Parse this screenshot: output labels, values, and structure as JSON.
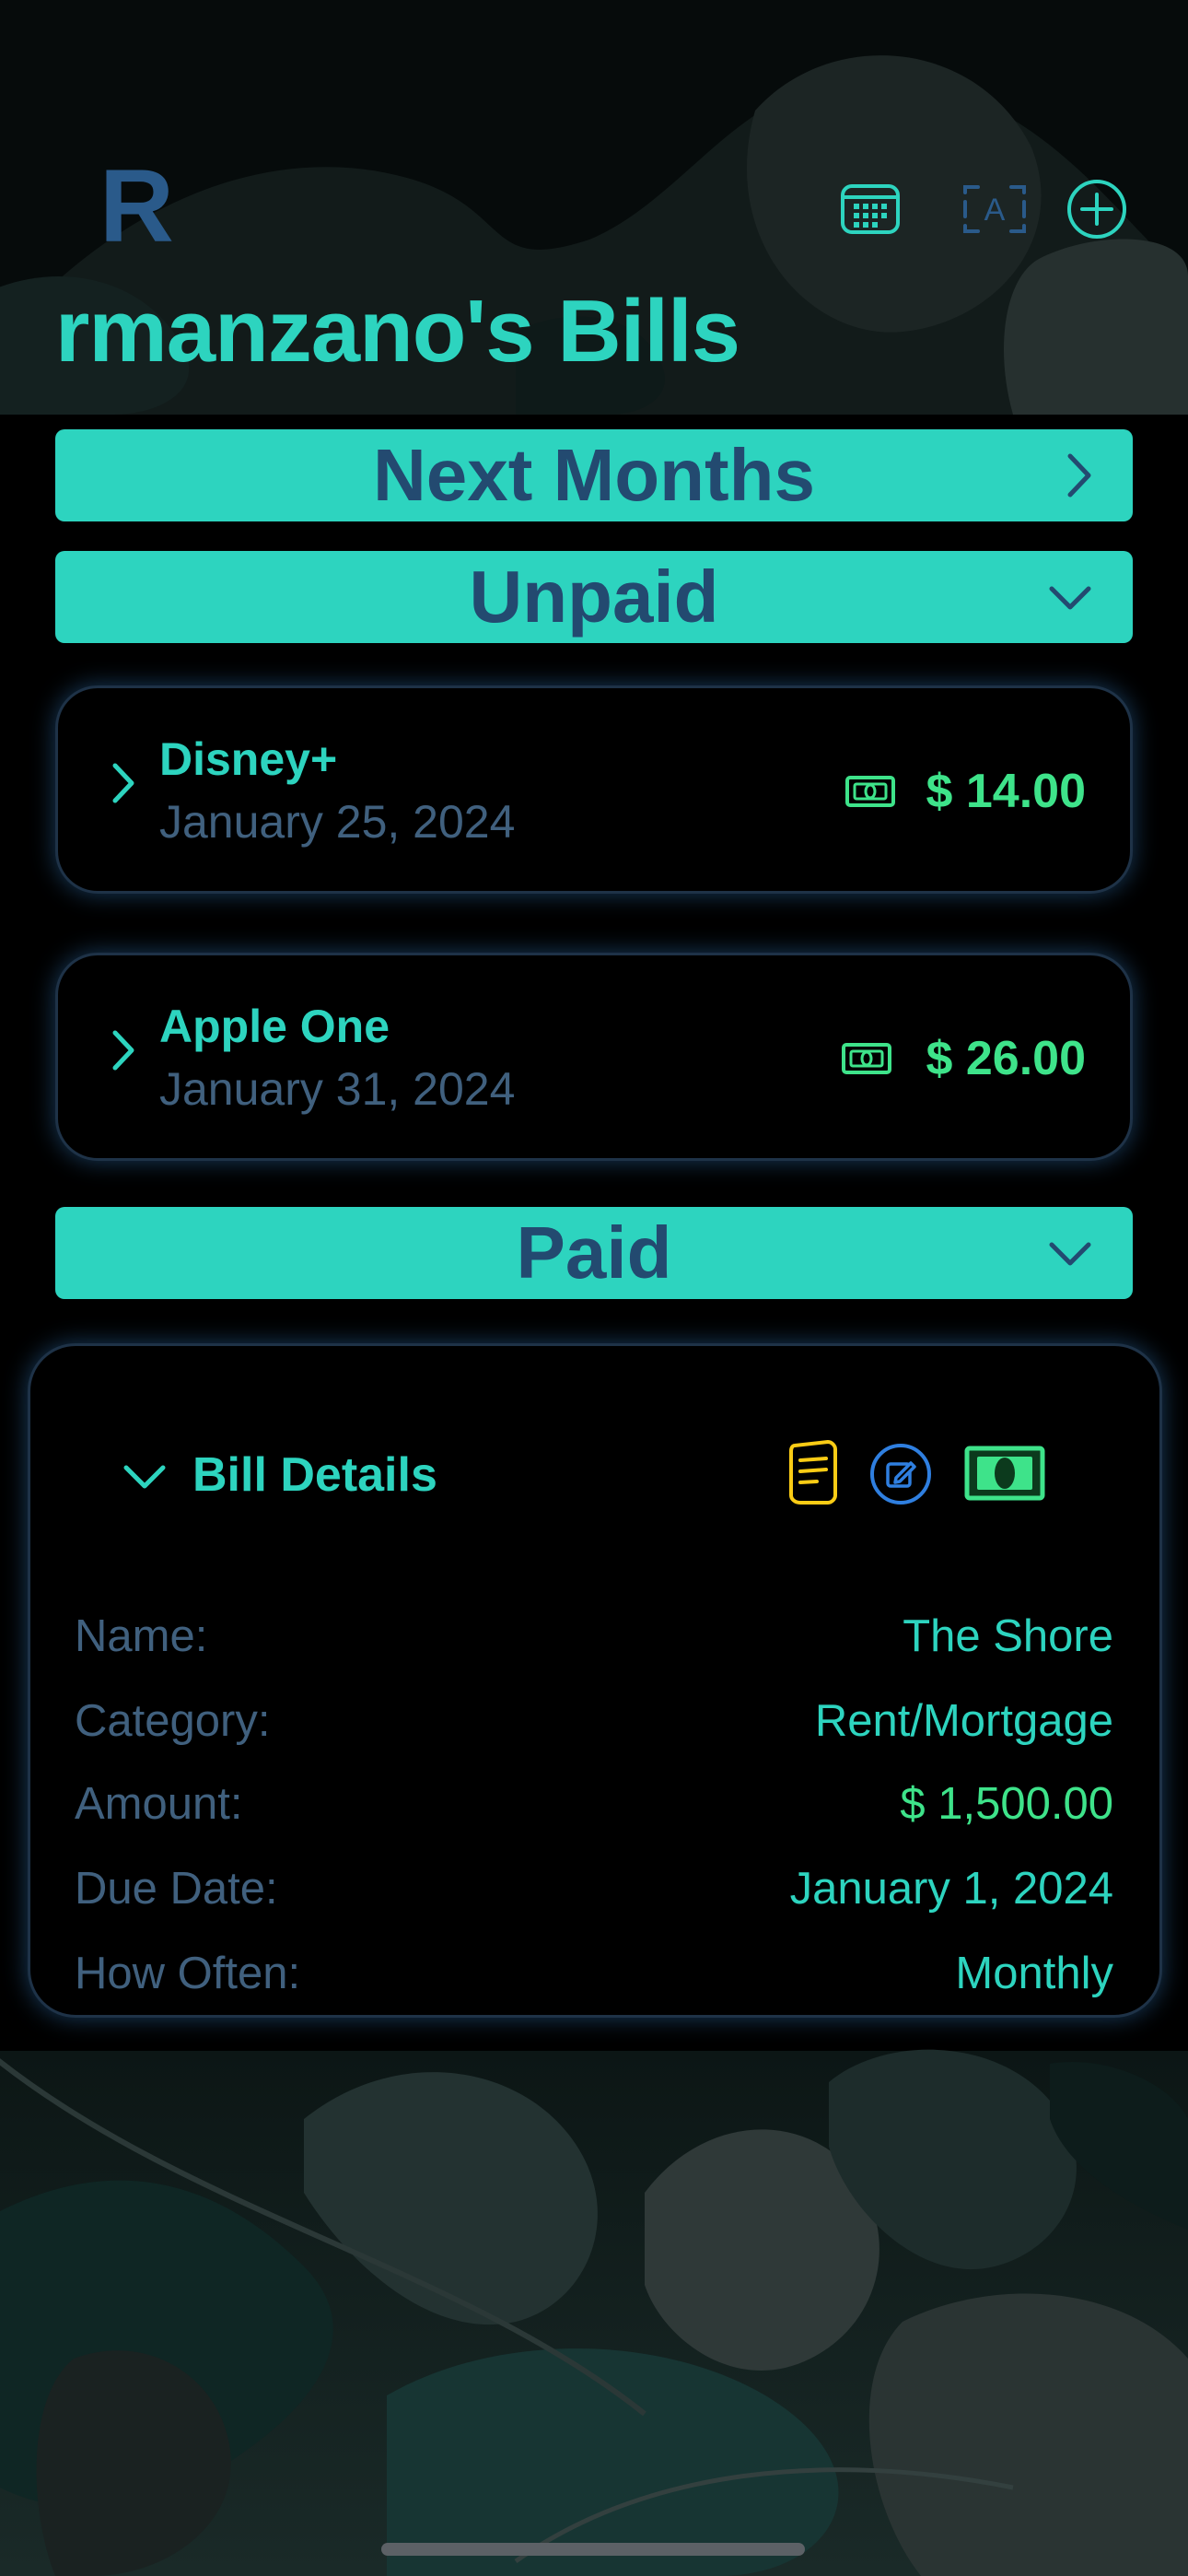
{
  "header": {
    "avatar_letter": "R",
    "title": "rmanzano's Bills",
    "icons": [
      "calendar-grid-icon",
      "text-format-icon",
      "add-circle-icon"
    ]
  },
  "sections": {
    "next_months": {
      "label": "Next Months",
      "icon": "chevron-right-icon"
    },
    "unpaid": {
      "label": "Unpaid",
      "icon": "chevron-down-icon"
    },
    "paid": {
      "label": "Paid",
      "icon": "chevron-down-icon"
    }
  },
  "unpaid_bills": [
    {
      "name": "Disney+",
      "date": "January 25, 2024",
      "amount": "$ 14.00"
    },
    {
      "name": "Apple One",
      "date": "January 31, 2024",
      "amount": "$ 26.00"
    }
  ],
  "bill_details": {
    "title": "Bill Details",
    "icons": [
      "notes-icon",
      "edit-icon",
      "cash-icon"
    ],
    "rows": [
      {
        "key": "Name:",
        "value": "The Shore"
      },
      {
        "key": "Category:",
        "value": "Rent/Mortgage"
      },
      {
        "key": "Amount:",
        "value": "$ 1,500.00"
      },
      {
        "key": "Due Date:",
        "value": "January 1, 2024"
      },
      {
        "key": "How Often:",
        "value": "Monthly"
      }
    ]
  },
  "colors": {
    "accent": "#2dd4bf",
    "section_text": "#234a70",
    "secondary_text": "#40607e",
    "money": "#3ee38a",
    "notes_icon": "#facc15",
    "edit_icon": "#2f7fe0",
    "background": "#000000"
  }
}
